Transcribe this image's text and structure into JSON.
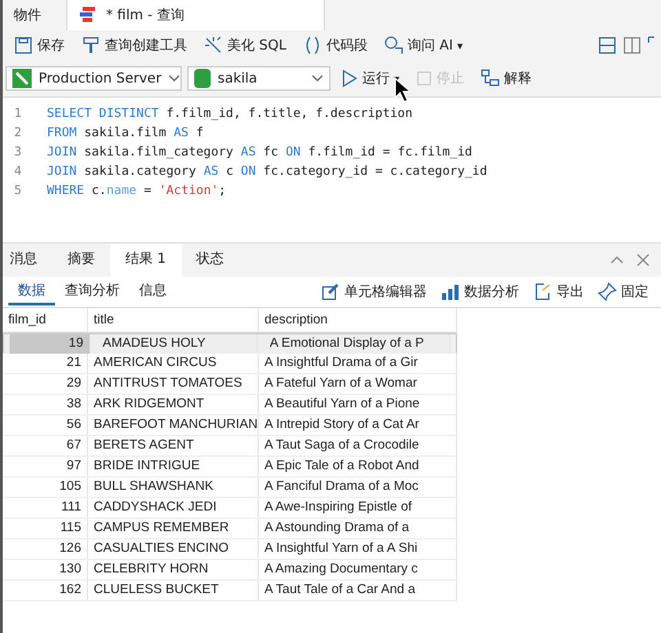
{
  "doc_tabs": [
    {
      "label": "物件",
      "selected": false
    },
    {
      "label": "* film - 查询",
      "selected": true
    }
  ],
  "toolbar": [
    {
      "label": "保存"
    },
    {
      "label": "查询创建工具"
    },
    {
      "label": "美化 SQL"
    },
    {
      "label": "代码段"
    },
    {
      "label": "询问 AI",
      "dropdown": "▾"
    }
  ],
  "connection": {
    "server": "Production Server",
    "database": "sakila"
  },
  "actions": [
    {
      "label": "运行",
      "kind": "run",
      "disabled": false,
      "dropdown": "▾"
    },
    {
      "label": "停止",
      "kind": "stop",
      "disabled": true
    },
    {
      "label": "解释",
      "kind": "explain",
      "disabled": false
    }
  ],
  "editor": {
    "lines": [
      {
        "number": "1",
        "tokens": [
          {
            "kind": "keyword",
            "text": "SELECT DISTINCT"
          },
          {
            "kind": "plain",
            "text": " f.film_id, f.title, f.description"
          }
        ]
      },
      {
        "number": "2",
        "tokens": [
          {
            "kind": "keyword",
            "text": "FROM"
          },
          {
            "kind": "plain",
            "text": " sakila.film "
          },
          {
            "kind": "keyword",
            "text": "AS"
          },
          {
            "kind": "plain",
            "text": " f"
          }
        ]
      },
      {
        "number": "3",
        "tokens": [
          {
            "kind": "keyword",
            "text": "JOIN"
          },
          {
            "kind": "plain",
            "text": " sakila.film_category "
          },
          {
            "kind": "keyword",
            "text": "AS"
          },
          {
            "kind": "plain",
            "text": " fc "
          },
          {
            "kind": "keyword",
            "text": "ON"
          },
          {
            "kind": "plain",
            "text": " f.film_id = fc.film_id"
          }
        ]
      },
      {
        "number": "4",
        "tokens": [
          {
            "kind": "keyword",
            "text": "JOIN"
          },
          {
            "kind": "plain",
            "text": " sakila.category "
          },
          {
            "kind": "keyword",
            "text": "AS"
          },
          {
            "kind": "plain",
            "text": " c "
          },
          {
            "kind": "keyword",
            "text": "ON"
          },
          {
            "kind": "plain",
            "text": " fc.category_id = c.category_id"
          }
        ]
      },
      {
        "number": "5",
        "tokens": [
          {
            "kind": "keyword",
            "text": "WHERE"
          },
          {
            "kind": "plain",
            "text": " c."
          },
          {
            "kind": "field",
            "text": "name"
          },
          {
            "kind": "plain",
            "text": " = "
          },
          {
            "kind": "string",
            "text": "'Action'"
          },
          {
            "kind": "plain",
            "text": ";"
          }
        ]
      }
    ]
  },
  "result_tabs": [
    {
      "label": "消息",
      "selected": false
    },
    {
      "label": "摘要",
      "selected": false
    },
    {
      "label": "结果 1",
      "selected": true
    },
    {
      "label": "状态",
      "selected": false
    }
  ],
  "sub_tabs": [
    {
      "label": "数据",
      "selected": true
    },
    {
      "label": "查询分析",
      "selected": false
    },
    {
      "label": "信息",
      "selected": false
    }
  ],
  "result_tools": [
    {
      "label": "单元格编辑器"
    },
    {
      "label": "数据分析"
    },
    {
      "label": "导出"
    },
    {
      "label": "固定"
    }
  ],
  "table": {
    "columns": [
      "film_id",
      "title",
      "description"
    ],
    "rows": [
      {
        "cells": [
          "19",
          "AMADEUS HOLY",
          "A Emotional Display of a P"
        ],
        "selected": true
      },
      {
        "cells": [
          "21",
          "AMERICAN CIRCUS",
          "A Insightful Drama of a Gir"
        ],
        "selected": false
      },
      {
        "cells": [
          "29",
          "ANTITRUST TOMATOES",
          "A Fateful Yarn of a Womar"
        ],
        "selected": false
      },
      {
        "cells": [
          "38",
          "ARK RIDGEMONT",
          "A Beautiful Yarn of a Pione"
        ],
        "selected": false
      },
      {
        "cells": [
          "56",
          "BAREFOOT MANCHURIAN",
          "A Intrepid Story of a Cat Ar"
        ],
        "selected": false
      },
      {
        "cells": [
          "67",
          "BERETS AGENT",
          "A Taut Saga of a Crocodile"
        ],
        "selected": false
      },
      {
        "cells": [
          "97",
          "BRIDE INTRIGUE",
          "A Epic Tale of a Robot And"
        ],
        "selected": false
      },
      {
        "cells": [
          "105",
          "BULL SHAWSHANK",
          "A Fanciful Drama of a Moc"
        ],
        "selected": false
      },
      {
        "cells": [
          "111",
          "CADDYSHACK JEDI",
          "A Awe-Inspiring Epistle of"
        ],
        "selected": false
      },
      {
        "cells": [
          "115",
          "CAMPUS REMEMBER",
          "A Astounding Drama of a"
        ],
        "selected": false
      },
      {
        "cells": [
          "126",
          "CASUALTIES ENCINO",
          "A Insightful Yarn of a A Shi"
        ],
        "selected": false
      },
      {
        "cells": [
          "130",
          "CELEBRITY HORN",
          "A Amazing Documentary c"
        ],
        "selected": false
      },
      {
        "cells": [
          "162",
          "CLUELESS BUCKET",
          "A Taut Tale of a Car And a"
        ],
        "selected": false
      }
    ]
  }
}
